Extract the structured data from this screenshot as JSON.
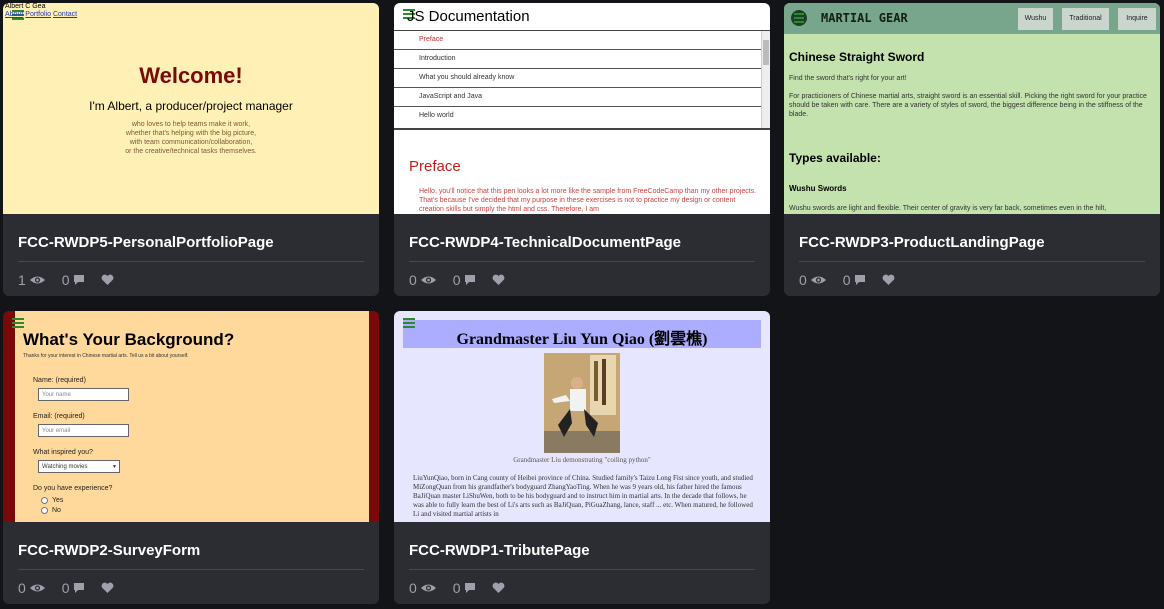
{
  "cards": [
    {
      "title": "FCC-RWDP5-PersonalPortfolioPage",
      "views": "1",
      "comments": "0",
      "preview": {
        "site_name": "Albert C Gea",
        "nav": [
          "About",
          "Portfolio",
          "Contact"
        ],
        "heading": "Welcome!",
        "subheading": "I'm Albert, a producer/project manager",
        "blurb": [
          "who loves to help teams make it work,",
          "whether that's helping with the big picture,",
          "with team communication/collaboration,",
          "or the creative/technical tasks themselves."
        ]
      }
    },
    {
      "title": "FCC-RWDP4-TechnicalDocumentPage",
      "views": "0",
      "comments": "0",
      "preview": {
        "heading": "JS Documentation",
        "nav": [
          "Preface",
          "Introduction",
          "What you should already know",
          "JavaScript and Java",
          "Hello world"
        ],
        "section_title": "Preface",
        "section_text": "Hello, you'll notice that this pen looks a lot more like the sample from FreeCodeCamp than my other projects. That's because I've decided that my purpose in these exercises is not to practice my design or content creation skills but simply the html and css. Therefore, I am"
      }
    },
    {
      "title": "FCC-RWDP3-ProductLandingPage",
      "views": "0",
      "comments": "0",
      "preview": {
        "brand": "MARTIAL GEAR",
        "nav": [
          "Wushu",
          "Traditional",
          "Inquire"
        ],
        "heading": "Chinese Straight Sword",
        "tagline": "Find the sword that's right for your art!",
        "intro": "For practicioners of Chinese martial arts, straight sword is an essential skill. Picking the right sword for your practice should be taken with care. There are a variety of styles of sword, the biggest difference being in the stiffness of the blade.",
        "types_heading": "Types available:",
        "subheading": "Wushu Swords",
        "sub_text": "Wushu swords are light and flexible. Their center of gravity is very far back, sometimes even in the hilt,"
      }
    },
    {
      "title": "FCC-RWDP2-SurveyForm",
      "views": "0",
      "comments": "0",
      "preview": {
        "heading": "What's Your Background?",
        "description": "Thanks for your interest in Chinese martial arts. Tell us a bit about yourself.",
        "name_label": "Name: (required)",
        "name_placeholder": "Your name",
        "email_label": "Email: (required)",
        "email_placeholder": "Your email",
        "inspired_label": "What inspired you?",
        "inspired_value": "Watching movies",
        "experience_label": "Do you have experience?",
        "options": [
          "Yes",
          "No"
        ]
      }
    },
    {
      "title": "FCC-RWDP1-TributePage",
      "views": "0",
      "comments": "0",
      "preview": {
        "heading": "Grandmaster Liu Yun Qiao (劉雲樵)",
        "caption": "Grandmaster Liu demonstrating \"coiling python\"",
        "bio": "LiuYunQiao, born in Cang county of Heibei province of China. Studied family's Taizu Long Fist since youth, and studied MiZongQuan from his grandfather's bodyguard ZhangYaoTing. When he was 9 years old, his father hired the famous BaJiQuan master LiShuWen, both to be his bodyguard and to instruct him in martial arts. In the decade that follows, he was able to fully learn the best of Li's arts such as BaJiQuan, PiGuaZhang, lance, staff ... etc. When matured, he followed Li and visited martial artists in"
      }
    }
  ],
  "icons": {
    "views": "eye-icon",
    "comments": "comment-icon",
    "like": "heart-icon",
    "menu": "hamburger-icon"
  },
  "colors": {
    "background": "#131417",
    "card": "#2c2d33",
    "stats": "#9ea0ab"
  }
}
